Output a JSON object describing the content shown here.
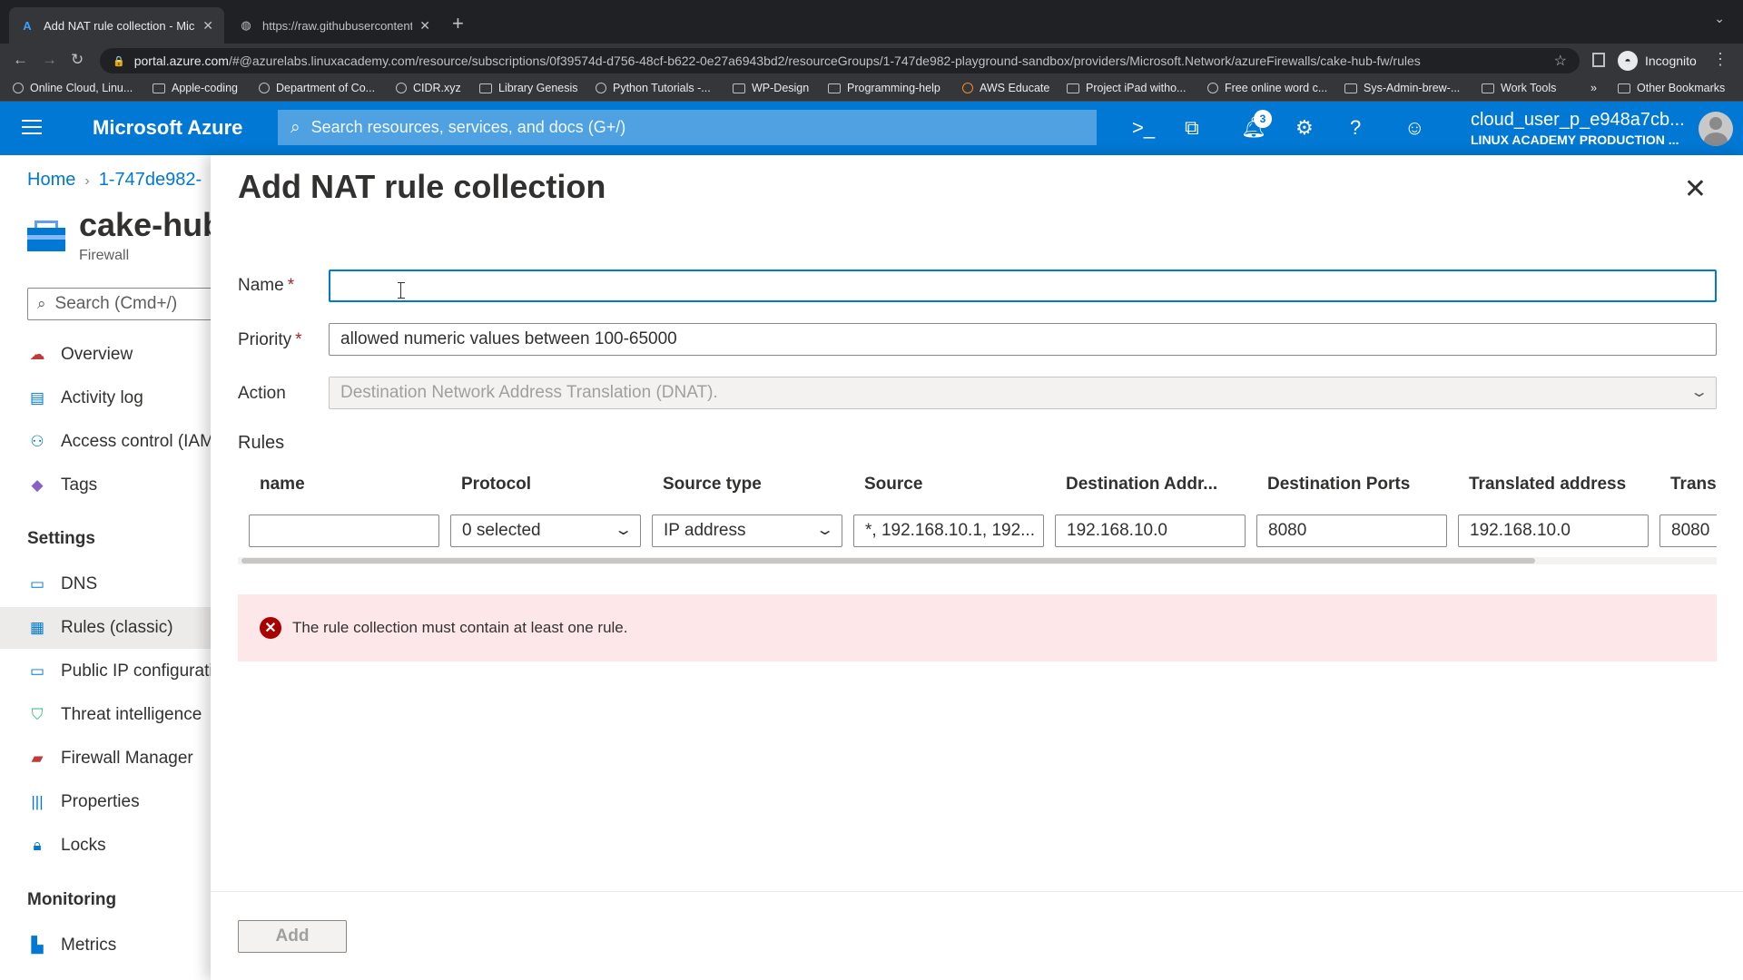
{
  "browser": {
    "tabs": [
      {
        "title": "Add NAT rule collection - Micr",
        "icon": "azure-icon"
      },
      {
        "title": "https://raw.githubusercontent.",
        "icon": "globe-icon"
      }
    ],
    "url_host": "portal.azure.com",
    "url_path": "/#@azurelabs.linuxacademy.com/resource/subscriptions/0f39574d-d756-48cf-b622-0e27a6943bd2/resourceGroups/1-747de982-playground-sandbox/providers/Microsoft.Network/azureFirewalls/cake-hub-fw/rules",
    "profile": "Incognito",
    "bookmarks": [
      "Online Cloud, Linu...",
      "Apple-coding",
      "Department of Co...",
      "CIDR.xyz",
      "Library Genesis",
      "Python Tutorials -...",
      "WP-Design",
      "Programming-help",
      "AWS Educate",
      "Project iPad witho...",
      "Free online word c...",
      "Sys-Admin-brew-...",
      "Work Tools"
    ],
    "bookmarks_overflow": "»",
    "other_bookmarks": "Other Bookmarks"
  },
  "azure": {
    "brand": "Microsoft Azure",
    "search_placeholder": "Search resources, services, and docs (G+/)",
    "notifications_count": "3",
    "user": "cloud_user_p_e948a7cb...",
    "tenant": "LINUX ACADEMY PRODUCTION ..."
  },
  "left": {
    "breadcrumb": [
      "Home",
      "1-747de982-"
    ],
    "resource_title": "cake-hub",
    "resource_type": "Firewall",
    "search_placeholder": "Search (Cmd+/)",
    "nav": [
      {
        "label": "Overview",
        "icon": "overview-icon"
      },
      {
        "label": "Activity log",
        "icon": "activity-log-icon"
      },
      {
        "label": "Access control (IAM)",
        "icon": "access-control-icon"
      },
      {
        "label": "Tags",
        "icon": "tag-icon"
      }
    ],
    "settings_header": "Settings",
    "settings": [
      {
        "label": "DNS",
        "icon": "dns-icon"
      },
      {
        "label": "Rules (classic)",
        "icon": "rules-icon",
        "selected": true
      },
      {
        "label": "Public IP configuration",
        "icon": "public-ip-icon"
      },
      {
        "label": "Threat intelligence",
        "icon": "shield-icon"
      },
      {
        "label": "Firewall Manager",
        "icon": "firewall-manager-icon"
      },
      {
        "label": "Properties",
        "icon": "properties-icon"
      },
      {
        "label": "Locks",
        "icon": "lock-icon"
      }
    ],
    "monitoring_header": "Monitoring",
    "monitoring": [
      {
        "label": "Metrics",
        "icon": "metrics-icon"
      }
    ]
  },
  "panel": {
    "title": "Add NAT rule collection",
    "name_label": "Name",
    "name_value": "",
    "priority_label": "Priority",
    "priority_placeholder": "allowed numeric values between 100-65000",
    "action_label": "Action",
    "action_value": "Destination Network Address Translation (DNAT).",
    "rules_label": "Rules",
    "columns": [
      "name",
      "Protocol",
      "Source type",
      "Source",
      "Destination Addr...",
      "Destination Ports",
      "Translated address",
      "Trans"
    ],
    "row": {
      "name": "",
      "protocol": "0 selected",
      "source_type": "IP address",
      "source": "*, 192.168.10.1, 192...",
      "destination_address": "192.168.10.0",
      "destination_ports": "8080",
      "translated_address": "192.168.10.0",
      "translated_port": "8080"
    },
    "error": "The rule collection must contain at least one rule.",
    "add_button": "Add"
  }
}
